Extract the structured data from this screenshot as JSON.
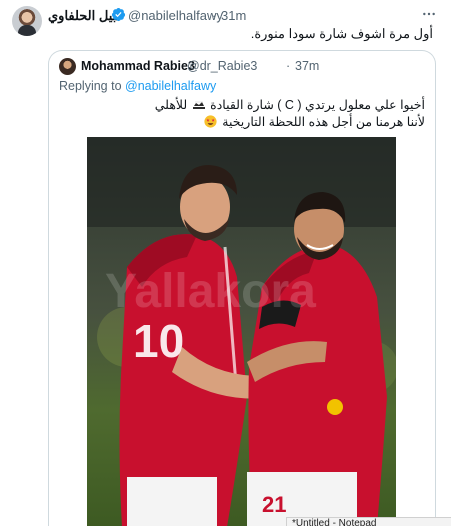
{
  "tweet": {
    "author_name": "نبيل الحلفاوي",
    "handle": "@nabilelhalfawy",
    "separator": "·",
    "time": "31m",
    "text": "أول مرة اشوف شارة سودا منورة."
  },
  "quote": {
    "author_name": "Mohammad Rabie3",
    "handle": "@dr_Rabie3",
    "separator": "·",
    "time": "37m",
    "reply_prefix": "Replying to ",
    "reply_mention": "@nabilelhalfawy",
    "line1_a": "أخيوا علي معلول يرتدي ( C ) شارة القيادة",
    "line1_b": "للأهلي",
    "line2": "لأننا هرمنا من أجل هذه اللحظة التاريخية",
    "photo_watermark": "Yallakora",
    "jersey_left": "10",
    "jersey_right": "21"
  },
  "window_hint": "*Untitled - Notepad",
  "colors": {
    "verified": "#1d9bf0",
    "link": "#1d9bf0",
    "secondary_text": "#536471",
    "jersey_red": "#c8102e",
    "pitch_green": "#3f6b2a"
  },
  "icons": {
    "verified": "verified-badge-icon",
    "more": "more-options-icon",
    "crown": "crown-icon",
    "emoji": "star-struck-emoji-icon"
  }
}
